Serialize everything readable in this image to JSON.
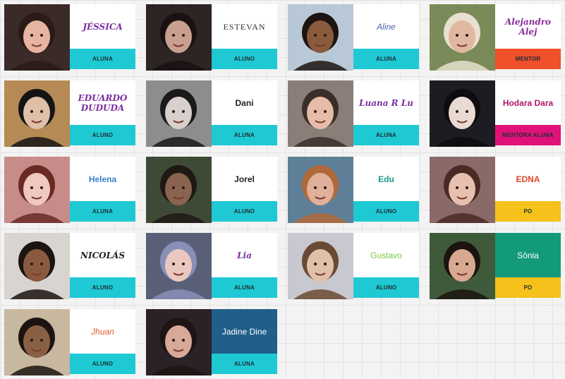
{
  "cards": [
    {
      "name": "JÉSSICA",
      "role": "ALUNA",
      "name_color": "#7b2ea0",
      "name_style": "n-hand",
      "name_bg": "#ffffff",
      "role_bg": "#1ec9d3",
      "photo": {
        "bg": "#3a2a28",
        "skin": "#e6b4a0",
        "hair": "#2b1a16"
      }
    },
    {
      "name": "ESTEVAN",
      "role": "ALUNO",
      "name_color": "#333333",
      "name_style": "n-serif",
      "name_bg": "#ffffff",
      "role_bg": "#1ec9d3",
      "photo": {
        "bg": "#2d2424",
        "skin": "#c9a08f",
        "hair": "#1a1212"
      }
    },
    {
      "name": "Aline",
      "role": "ALUNA",
      "name_color": "#4a5fb0",
      "name_style": "n-italic",
      "name_bg": "#ffffff",
      "role_bg": "#1ec9d3",
      "photo": {
        "bg": "#b9c8d6",
        "skin": "#8a5a3c",
        "hair": "#1c1410"
      }
    },
    {
      "name": "Alejandro Alej",
      "role": "MENTOR",
      "name_color": "#8b2a9e",
      "name_style": "n-hand",
      "name_bg": "#ffffff",
      "role_bg": "#f0502a",
      "photo": {
        "bg": "#7a8a58",
        "skin": "#e0b8a0",
        "hair": "#e8e0d0"
      }
    },
    {
      "name": "EDUARDO DUDUDA",
      "role": "ALUNO",
      "name_color": "#7b2ea0",
      "name_style": "n-hand",
      "name_bg": "#ffffff",
      "role_bg": "#1ec9d3",
      "photo": {
        "bg": "#b58a55",
        "skin": "#e0bfa8",
        "hair": "#141414"
      }
    },
    {
      "name": "Dani",
      "role": "ALUNA",
      "name_color": "#222222",
      "name_style": "n-bold",
      "name_bg": "#ffffff",
      "role_bg": "#1ec9d3",
      "photo": {
        "bg": "#8d8d8d",
        "skin": "#d8d0cc",
        "hair": "#1a1a1a"
      }
    },
    {
      "name": "Luana R Lu",
      "role": "ALUNA",
      "name_color": "#7b2ea0",
      "name_style": "n-hand",
      "name_bg": "#ffffff",
      "role_bg": "#1ec9d3",
      "photo": {
        "bg": "#8a7f78",
        "skin": "#e6bca8",
        "hair": "#3a2e2a"
      }
    },
    {
      "name": "Hodara Dara",
      "role": "MENTORA ALUNA",
      "name_color": "#b0186a",
      "name_style": "n-bold",
      "name_bg": "#ffffff",
      "role_bg": "#e0127a",
      "photo": {
        "bg": "#1c1c22",
        "skin": "#eadad4",
        "hair": "#0e0c10"
      }
    },
    {
      "name": "Helena",
      "role": "ALUNA",
      "name_color": "#3a7fd0",
      "name_style": "n-bold",
      "name_bg": "#ffffff",
      "role_bg": "#1ec9d3",
      "photo": {
        "bg": "#c78c8a",
        "skin": "#efc8c0",
        "hair": "#6a2a24"
      }
    },
    {
      "name": "Jorel",
      "role": "ALUNO",
      "name_color": "#222222",
      "name_style": "n-bold",
      "name_bg": "#ffffff",
      "role_bg": "#1ec9d3",
      "photo": {
        "bg": "#3e4a36",
        "skin": "#8a6450",
        "hair": "#201814"
      }
    },
    {
      "name": "Edu",
      "role": "ALUNO",
      "name_color": "#1a9a8a",
      "name_style": "n-bold",
      "name_bg": "#ffffff",
      "role_bg": "#1ec9d3",
      "photo": {
        "bg": "#5f7f98",
        "skin": "#e0b09a",
        "hair": "#b06a3a"
      }
    },
    {
      "name": "EDNA",
      "role": "PO",
      "name_color": "#e0452a",
      "name_style": "n-bold",
      "name_bg": "#ffffff",
      "role_bg": "#f5c11a",
      "photo": {
        "bg": "#8a6a68",
        "skin": "#e8c0b0",
        "hair": "#4a2a24"
      }
    },
    {
      "name": "NICOLÁS",
      "role": "ALUNO",
      "name_color": "#222222",
      "name_style": "n-hand",
      "name_bg": "#ffffff",
      "role_bg": "#1ec9d3",
      "photo": {
        "bg": "#d8d4d0",
        "skin": "#8a5a40",
        "hair": "#1c1410"
      }
    },
    {
      "name": "Lia",
      "role": "ALUNA",
      "name_color": "#7b2ea0",
      "name_style": "n-hand",
      "name_bg": "#ffffff",
      "role_bg": "#1ec9d3",
      "photo": {
        "bg": "#5a5f78",
        "skin": "#eac8c0",
        "hair": "#8890b8"
      }
    },
    {
      "name": "Gustavo",
      "role": "ALUNO",
      "name_color": "#7ac943",
      "name_style": "",
      "name_bg": "#ffffff",
      "role_bg": "#1ec9d3",
      "photo": {
        "bg": "#c8c8d0",
        "skin": "#e0c0a8",
        "hair": "#6a4a34"
      }
    },
    {
      "name": "Sônia",
      "role": "PO",
      "name_color": "#ffffff",
      "name_style": "",
      "name_bg": "#139a7a",
      "role_bg": "#f5c11a",
      "photo": {
        "bg": "#3f5a3a",
        "skin": "#d8a890",
        "hair": "#1c1410"
      }
    },
    {
      "name": "Jhuan",
      "role": "ALUNO",
      "name_color": "#e0602a",
      "name_style": "n-italic",
      "name_bg": "#ffffff",
      "role_bg": "#1ec9d3",
      "photo": {
        "bg": "#c8b8a0",
        "skin": "#8a6044",
        "hair": "#1c1410"
      }
    },
    {
      "name": "Jadine Dine",
      "role": "ALUNA",
      "name_color": "#ffffff",
      "name_style": "",
      "name_bg": "#1f5f8a",
      "role_bg": "#1ec9d3",
      "photo": {
        "bg": "#2a2226",
        "skin": "#d8a898",
        "hair": "#1e1414"
      }
    }
  ]
}
